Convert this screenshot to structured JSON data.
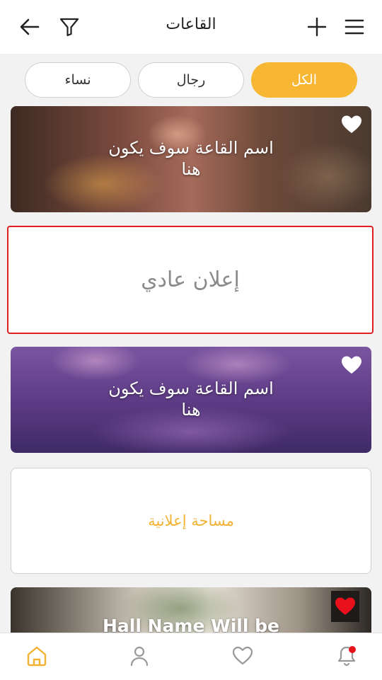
{
  "header": {
    "title": "القاعات",
    "icons": [
      "back-arrow-icon",
      "filter-icon",
      "plus-icon",
      "menu-icon"
    ]
  },
  "filters": [
    {
      "label": "نساء",
      "active": false
    },
    {
      "label": "رجال",
      "active": false
    },
    {
      "label": "الكل",
      "active": true
    }
  ],
  "colors": {
    "accent": "#f7b733",
    "ad_border": "#e02020",
    "heart_active": "#e8101a"
  },
  "halls": [
    {
      "name_line1": "اسم القاعة سوف يكون",
      "name_line2": "هنا",
      "favorite": false
    },
    {
      "name_line1": "اسم القاعة سوف يكون",
      "name_line2": "هنا",
      "favorite": false
    },
    {
      "name_line1": "Hall Name Will be",
      "favorite": true
    }
  ],
  "ads": {
    "normal_label": "إعلان عادي",
    "space_label": "مساحة إعلانية"
  },
  "bottom_nav": {
    "items": [
      "home-icon",
      "profile-icon",
      "favorites-icon",
      "notifications-icon"
    ],
    "active": "home-icon",
    "has_notification_dot": true
  }
}
